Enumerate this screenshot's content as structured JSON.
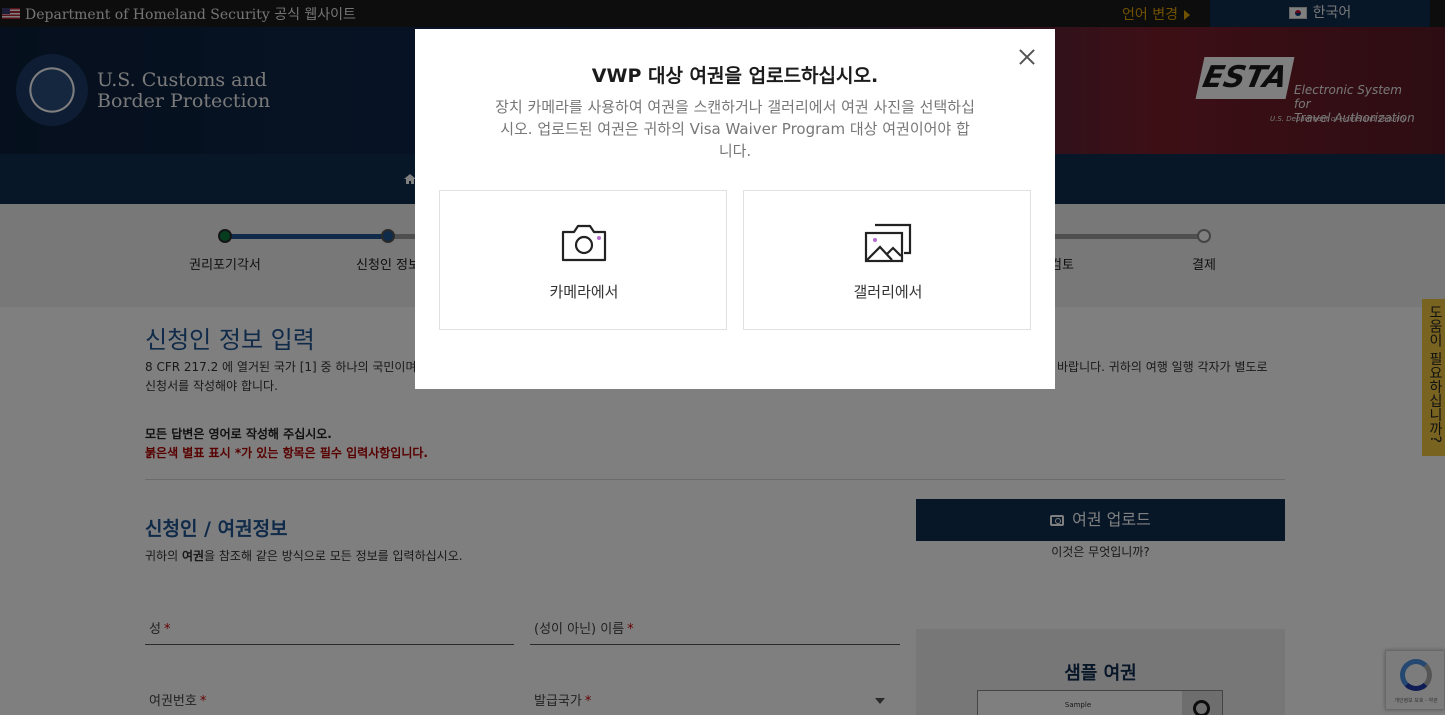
{
  "gov_bar": {
    "text": "Department of Homeland Security 공식 웹사이트",
    "lang_change": "언어 변경",
    "current_lang": "한국어"
  },
  "header": {
    "agency_line1": "U.S. Customs and",
    "agency_line2": "Border Protection",
    "esta_logo": "ESTA",
    "esta_sub1": "Electronic System for",
    "esta_sub2": "Travel Authorization",
    "esta_dhs": "U.S. Department of Homeland Security"
  },
  "progress": {
    "steps": [
      {
        "label": "권리포기각서",
        "state": "done"
      },
      {
        "label": "신청인 정보",
        "state": "current"
      },
      {
        "label": "검토",
        "state": "todo"
      },
      {
        "label": "결제",
        "state": "todo"
      }
    ]
  },
  "content": {
    "page_title": "신청인 정보 입력",
    "intro_left": "8 CFR 217.2 에 열거된 국가 [1] 중 하나의 국민이며",
    "intro_right": "바랍니다. 귀하의 여행 일행 각자가 별도로",
    "intro_line2": "신청서를 작성해야 합니다.",
    "note_english": "모든 답변은 영어로 작성해 주십시오.",
    "note_required": "붉은색 별표 표시 *가 있는 항목은 필수 입력사항입니다.",
    "section_title": "신청인 / 여권정보",
    "section_sub_before": "귀하의 ",
    "section_sub_bold": "여권",
    "section_sub_after": "을 참조해 같은 방식으로 모든 정보를 입력하십시오.",
    "fields": {
      "surname": "성",
      "given_name": "(성이 아닌) 이름",
      "passport_number": "여권번호",
      "issuing_country": "발급국가",
      "required_mark": "*"
    },
    "upload_button": "여권 업로드",
    "what_is_this": "이것은 무엇입니까?",
    "sample_title": "샘플 여권",
    "sample_label": "Sample"
  },
  "help_tab": "도움이 필요하십니까?",
  "recaptcha_text": "개인정보 보호 - 약관",
  "modal": {
    "title": "VWP 대상 여권을 업로드하십시오.",
    "description": "장치 카메라를 사용하여 여권을 스캔하거나 갤러리에서 여권 사진을 선택하십시오. 업로드된 여권은 귀하의 Visa Waiver Program 대상 여권이어야 합니다.",
    "camera_option": "카메라에서",
    "gallery_option": "갤러리에서"
  }
}
